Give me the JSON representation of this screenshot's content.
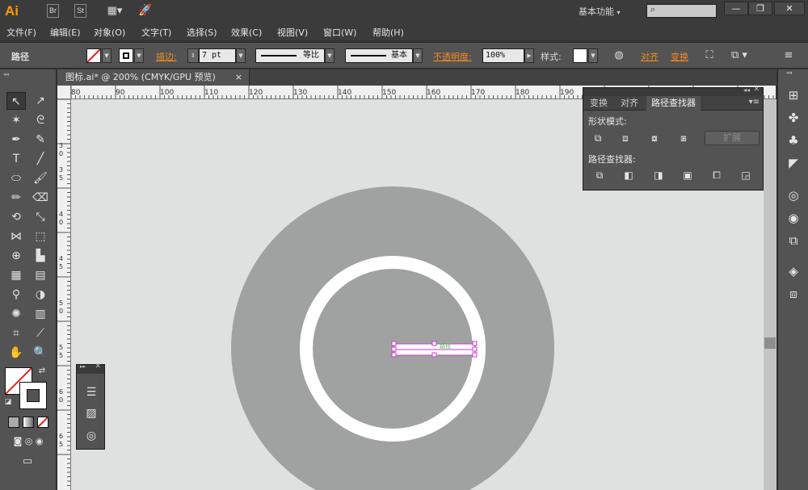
{
  "app": {
    "logo": "Ai",
    "icon_br": "Br",
    "icon_st": "St",
    "workspace": "基本功能",
    "window_minimize": "—",
    "window_restore": "❐",
    "window_close": "✕"
  },
  "menu": [
    "文件(F)",
    "编辑(E)",
    "对象(O)",
    "文字(T)",
    "选择(S)",
    "效果(C)",
    "视图(V)",
    "窗口(W)",
    "帮助(H)"
  ],
  "control": {
    "object_type": "路径",
    "stroke_label": "描边:",
    "stroke_weight": "7 pt",
    "profile_label": "等比",
    "brush_label": "基本",
    "opacity_label": "不透明度:",
    "opacity_value": "100%",
    "style_label": "样式:",
    "align_label": "对齐",
    "transform_label": "变换"
  },
  "document": {
    "tab_title": "图标.ai* @ 200% (CMYK/GPU 预览)",
    "close": "×",
    "ruler_h_ticks": [
      "80",
      "90",
      "100",
      "110",
      "120",
      "130",
      "140",
      "150",
      "160",
      "170",
      "180",
      "190"
    ],
    "ruler_v_ticks": [
      "3",
      "0",
      "3",
      "5",
      "4",
      "0",
      "4",
      "5",
      "5",
      "0",
      "5",
      "5",
      "6",
      "0",
      "6",
      "5"
    ],
    "selection_label": "路径"
  },
  "pathfinder": {
    "tabs": [
      "变换",
      "对齐",
      "路径查找器"
    ],
    "shape_modes_title": "形状模式:",
    "expand_button": "扩展",
    "pathfinders_title": "路径查找器:"
  },
  "colors": {
    "canvas_bg": "#dfe1e1",
    "outer_circle": "#a0a2a1",
    "ring": "#ffffff",
    "selection": "#c93ec9",
    "accent_orange": "#f08a24"
  }
}
